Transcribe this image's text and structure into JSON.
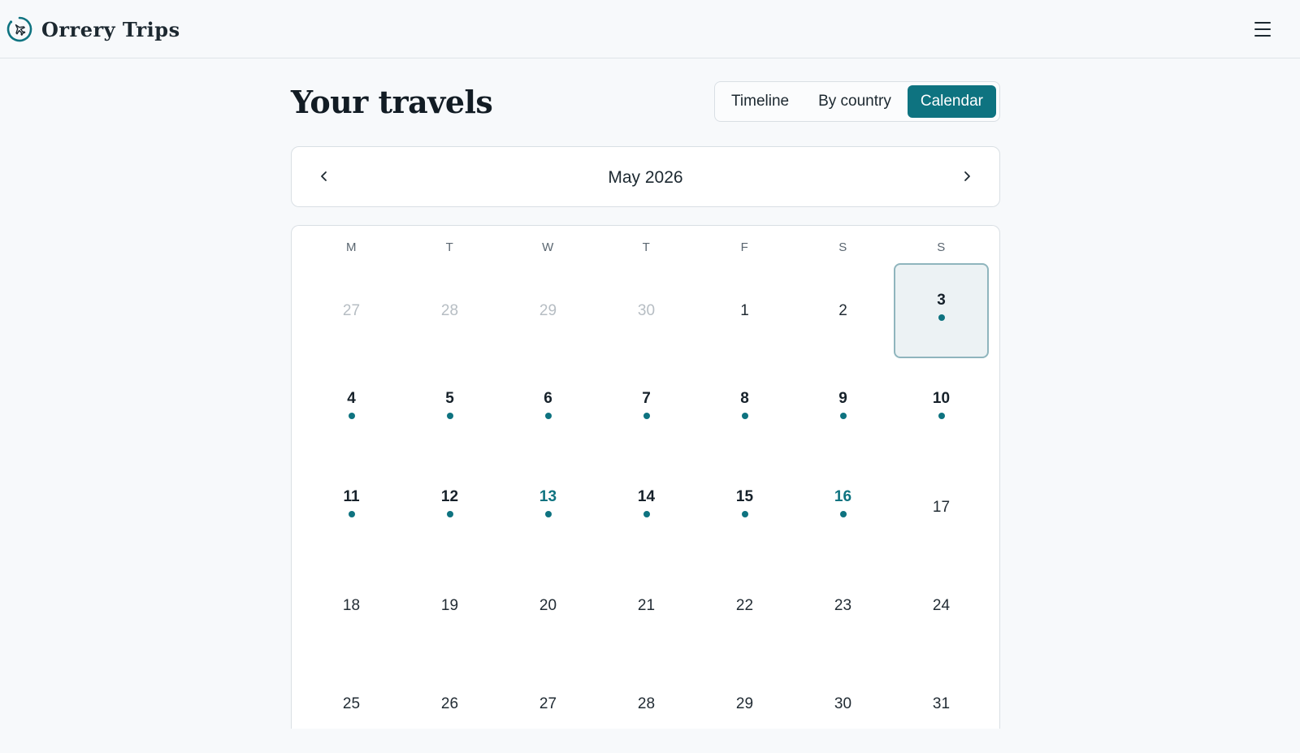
{
  "brand": {
    "name": "Orrery Trips",
    "logo_icon": "orbit-plane-icon",
    "accent": "#0e7380"
  },
  "header": {
    "menu_icon": "hamburger-menu-icon"
  },
  "page": {
    "title": "Your travels"
  },
  "view_switch": {
    "tabs": [
      {
        "label": "Timeline",
        "active": false
      },
      {
        "label": "By country",
        "active": false
      },
      {
        "label": "Calendar",
        "active": true
      }
    ]
  },
  "month_nav": {
    "label": "May 2026",
    "prev_icon": "chevron-left-icon",
    "next_icon": "chevron-right-icon"
  },
  "calendar": {
    "weekdays": [
      "M",
      "T",
      "W",
      "T",
      "F",
      "S",
      "S"
    ],
    "days": [
      {
        "n": "27",
        "other": true
      },
      {
        "n": "28",
        "other": true
      },
      {
        "n": "29",
        "other": true
      },
      {
        "n": "30",
        "other": true
      },
      {
        "n": "1"
      },
      {
        "n": "2"
      },
      {
        "n": "3",
        "trip": true,
        "selected": true
      },
      {
        "n": "4",
        "trip": true
      },
      {
        "n": "5",
        "trip": true
      },
      {
        "n": "6",
        "trip": true
      },
      {
        "n": "7",
        "trip": true
      },
      {
        "n": "8",
        "trip": true
      },
      {
        "n": "9",
        "trip": true
      },
      {
        "n": "10",
        "trip": true
      },
      {
        "n": "11",
        "trip": true
      },
      {
        "n": "12",
        "trip": true
      },
      {
        "n": "13",
        "trip": true,
        "highlight": true
      },
      {
        "n": "14",
        "trip": true
      },
      {
        "n": "15",
        "trip": true
      },
      {
        "n": "16",
        "trip": true,
        "highlight": true
      },
      {
        "n": "17"
      },
      {
        "n": "18"
      },
      {
        "n": "19"
      },
      {
        "n": "20"
      },
      {
        "n": "21"
      },
      {
        "n": "22"
      },
      {
        "n": "23"
      },
      {
        "n": "24"
      },
      {
        "n": "25"
      },
      {
        "n": "26"
      },
      {
        "n": "27"
      },
      {
        "n": "28"
      },
      {
        "n": "29"
      },
      {
        "n": "30"
      },
      {
        "n": "31"
      }
    ]
  }
}
